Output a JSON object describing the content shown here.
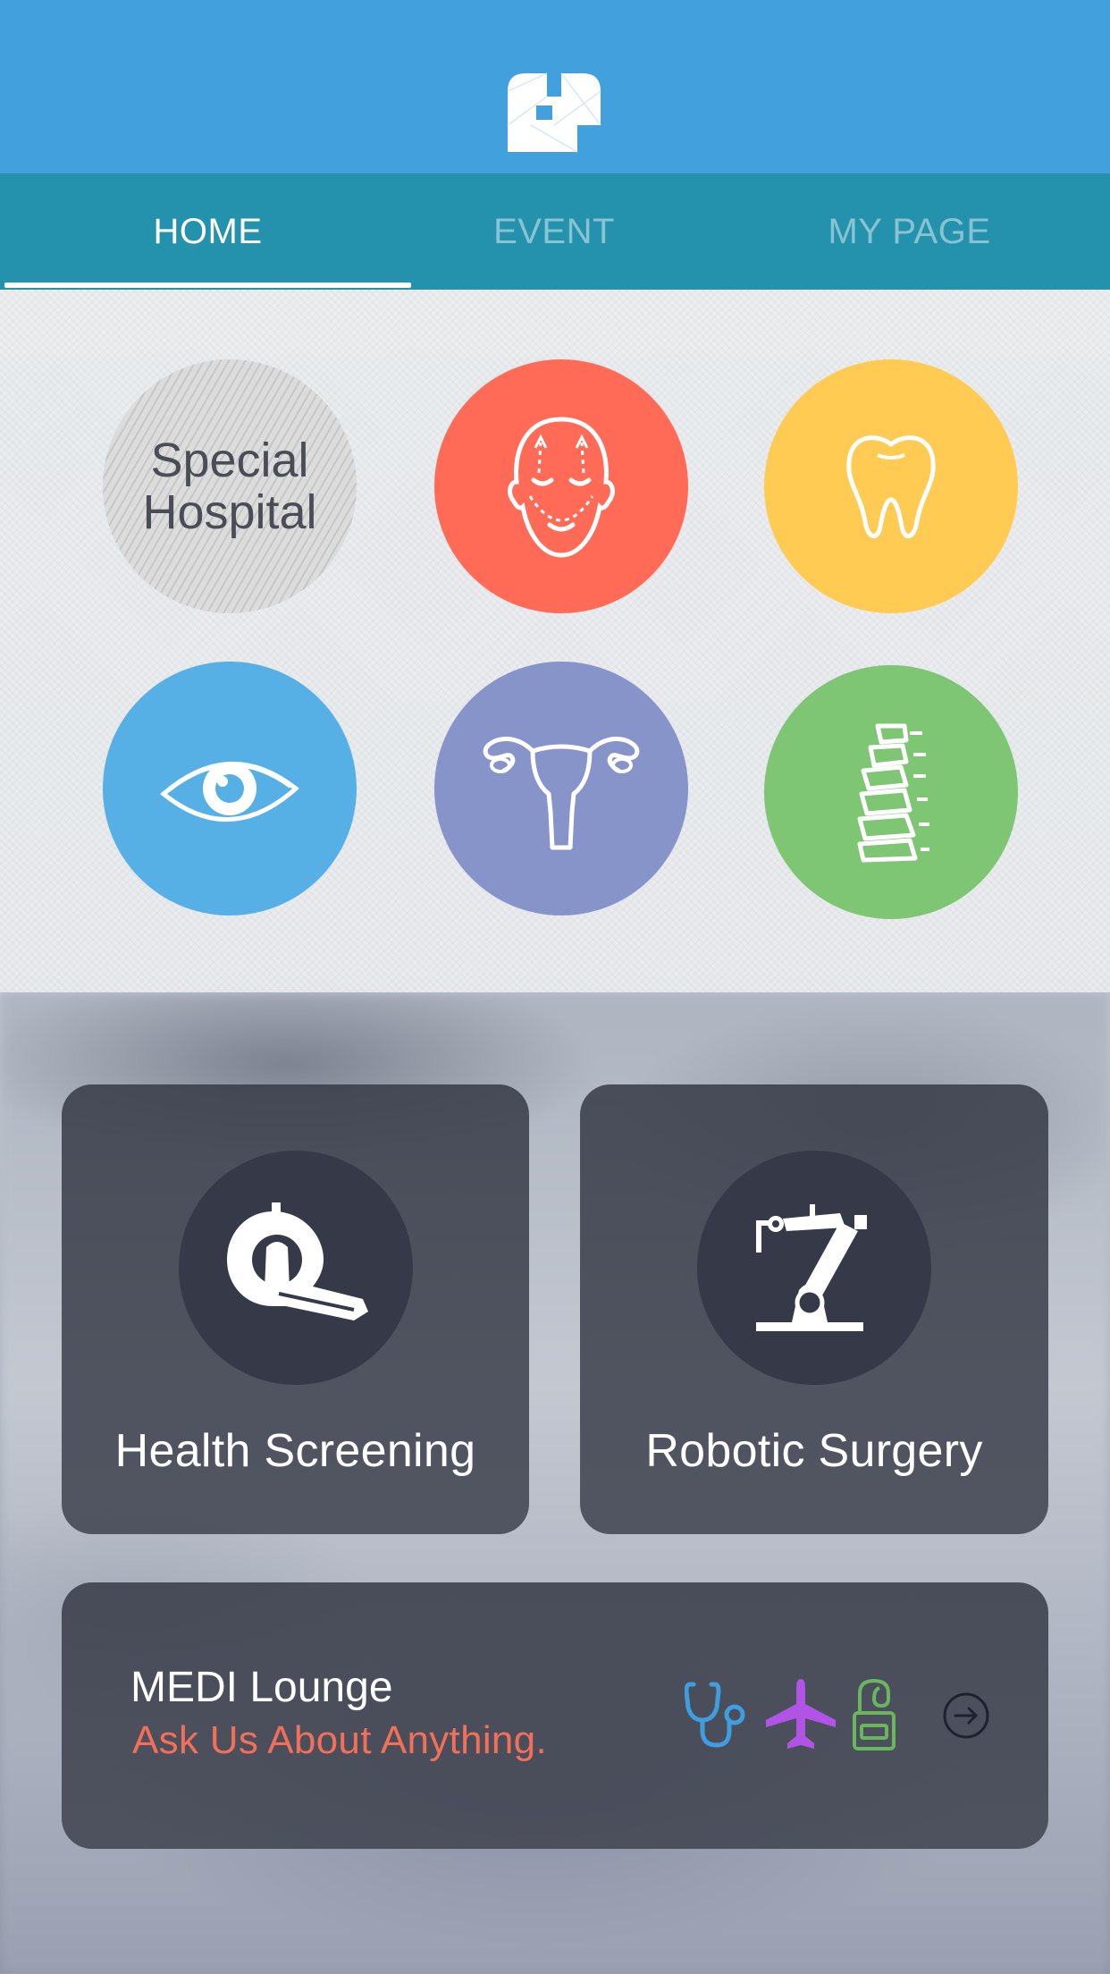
{
  "header": {
    "logo": "app-logo-icon",
    "color": "#42a1dd"
  },
  "tabs": [
    {
      "label": "HOME",
      "active": true
    },
    {
      "label": "EVENT",
      "active": false
    },
    {
      "label": "MY PAGE",
      "active": false
    }
  ],
  "categories": {
    "special": {
      "line1": "Special",
      "line2": "Hospital"
    },
    "items": [
      {
        "icon": "face-icon",
        "color": "#ff6b57"
      },
      {
        "icon": "tooth-icon",
        "color": "#ffcb52"
      },
      {
        "icon": "eye-icon",
        "color": "#56b0e6"
      },
      {
        "icon": "uterus-icon",
        "color": "#8794c9"
      },
      {
        "icon": "spine-icon",
        "color": "#7ec574"
      }
    ]
  },
  "cards": {
    "health_screening": {
      "label": "Health Screening",
      "icon": "ct-scanner-icon"
    },
    "robotic_surgery": {
      "label": "Robotic Surgery",
      "icon": "robot-arm-icon"
    }
  },
  "lounge": {
    "title": "MEDI Lounge",
    "subtitle": "Ask Us About Anything.",
    "icons": [
      "stethoscope-icon",
      "airplane-icon",
      "door-hanger-icon",
      "arrow-right-icon"
    ],
    "accent": "#f26f5a"
  }
}
